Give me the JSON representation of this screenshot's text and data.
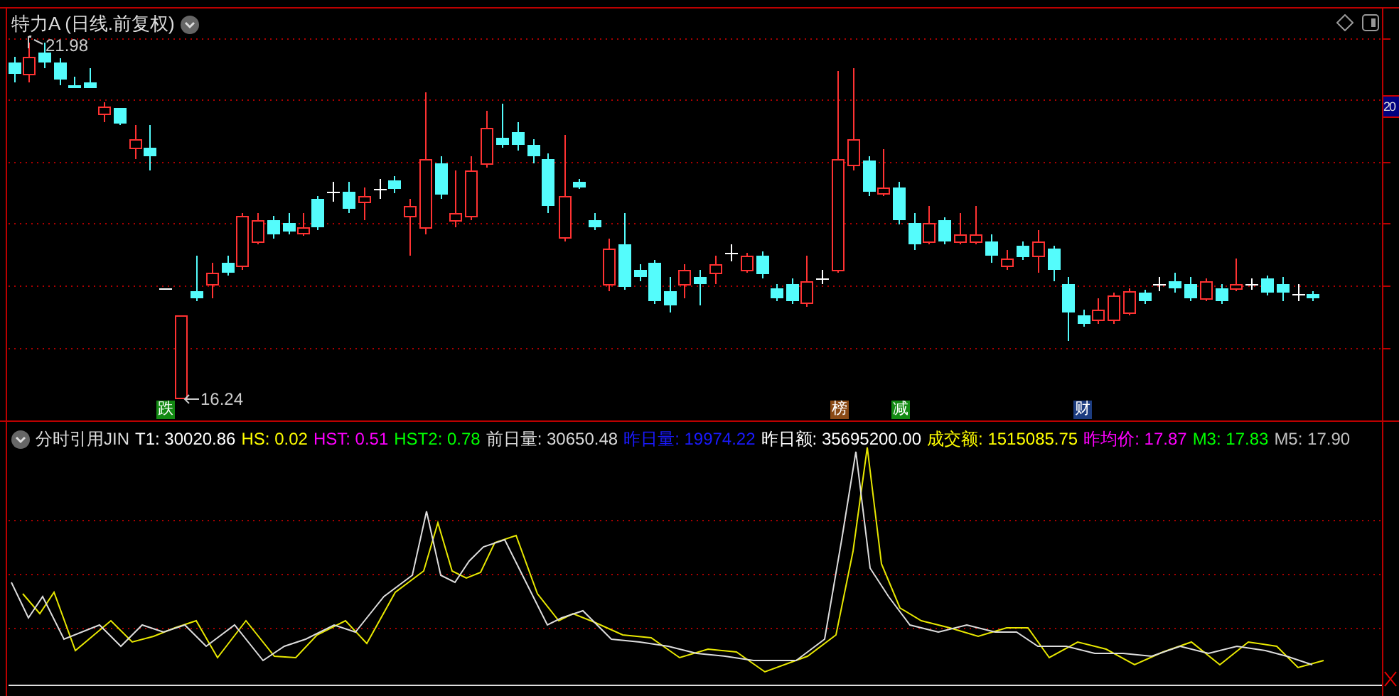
{
  "main_panel": {
    "title": "特力A (日线.前复权)",
    "high_label": "21.98",
    "low_label": "16.24",
    "axis_label": "20",
    "markers": [
      {
        "text": "跌",
        "color": "#128a12"
      },
      {
        "text": "榜",
        "color": "#8a4a16"
      },
      {
        "text": "减",
        "color": "#128a12"
      },
      {
        "text": "财",
        "color": "#1c3c80"
      }
    ]
  },
  "indicator_panel": {
    "name": "分时引用JIN",
    "fields": [
      {
        "label": "T1:",
        "value": "30020.86",
        "color": "#ffffff"
      },
      {
        "label": "HS:",
        "value": "0.02",
        "color": "#ffff00"
      },
      {
        "label": "HST:",
        "value": "0.51",
        "color": "#ff00ff"
      },
      {
        "label": "HST2:",
        "value": "0.78",
        "color": "#00ff00"
      },
      {
        "label": "前日量:",
        "value": "30650.48",
        "color": "#d8d8d8"
      },
      {
        "label": "昨日量:",
        "value": "19974.22",
        "color": "#1a1aff"
      },
      {
        "label": "昨日额:",
        "value": "35695200.00",
        "color": "#ffffff"
      },
      {
        "label": "成交额:",
        "value": "1515085.75",
        "color": "#ffff00"
      },
      {
        "label": "昨均价:",
        "value": "17.87",
        "color": "#ff00ff"
      },
      {
        "label": "M3:",
        "value": "17.83",
        "color": "#00ff00"
      },
      {
        "label": "M5:",
        "value": "17.90",
        "color": "#c0c0c0"
      }
    ]
  }
}
